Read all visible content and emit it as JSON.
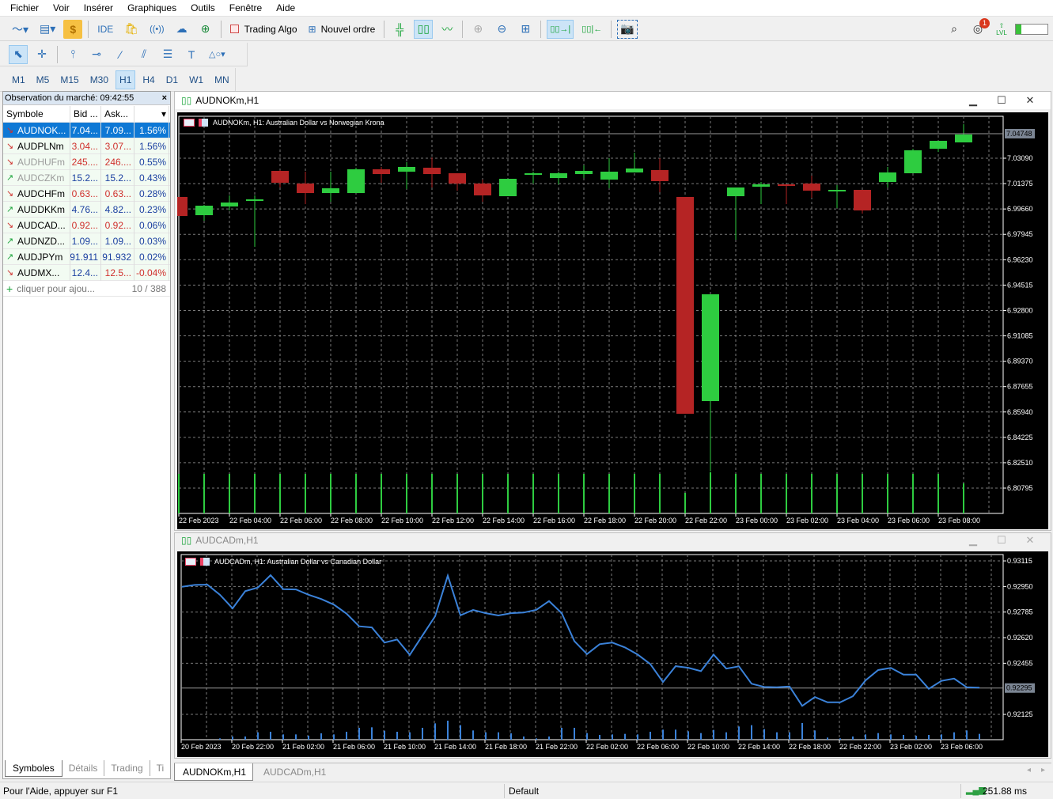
{
  "menu": [
    "Fichier",
    "Voir",
    "Insérer",
    "Graphiques",
    "Outils",
    "Fenêtre",
    "Aide"
  ],
  "toolbar": {
    "ide": "IDE",
    "trading_algo": "Trading Algo",
    "new_order": "Nouvel ordre",
    "notif_count": "1",
    "lvl": "LVL",
    "level_fill": 0.18
  },
  "timeframes": [
    "M1",
    "M5",
    "M15",
    "M30",
    "H1",
    "H4",
    "D1",
    "W1",
    "MN"
  ],
  "timeframe_active": "H1",
  "market_watch": {
    "title": "Observation du marché: 09:42:55",
    "columns": [
      "Symbole",
      "Bid ...",
      "Ask...",
      ""
    ],
    "rows": [
      {
        "symbol": "AUDNOK...",
        "bid": "7.04...",
        "ask": "7.09...",
        "change": "1.56%",
        "dir": "down",
        "bid_color": "#ffffff",
        "ask_color": "#ffffff",
        "chg_color": "#ffffff",
        "sym_color": "#ffffff",
        "selected": true
      },
      {
        "symbol": "AUDPLNm",
        "bid": "3.04...",
        "ask": "3.07...",
        "change": "1.56%",
        "dir": "down",
        "bid_color": "#d0312d",
        "ask_color": "#d0312d",
        "chg_color": "#1a3fa0",
        "sym_color": "#000000"
      },
      {
        "symbol": "AUDHUFm",
        "bid": "245....",
        "ask": "246....",
        "change": "0.55%",
        "dir": "down",
        "bid_color": "#d0312d",
        "ask_color": "#d0312d",
        "chg_color": "#1a3fa0",
        "sym_color": "#9a9a9a"
      },
      {
        "symbol": "AUDCZKm",
        "bid": "15.2...",
        "ask": "15.2...",
        "change": "0.43%",
        "dir": "up",
        "bid_color": "#1a3fa0",
        "ask_color": "#1a3fa0",
        "chg_color": "#1a3fa0",
        "sym_color": "#9a9a9a"
      },
      {
        "symbol": "AUDCHFm",
        "bid": "0.63...",
        "ask": "0.63...",
        "change": "0.28%",
        "dir": "down",
        "bid_color": "#d0312d",
        "ask_color": "#d0312d",
        "chg_color": "#1a3fa0",
        "sym_color": "#000000"
      },
      {
        "symbol": "AUDDKKm",
        "bid": "4.76...",
        "ask": "4.82...",
        "change": "0.23%",
        "dir": "up",
        "bid_color": "#1a3fa0",
        "ask_color": "#1a3fa0",
        "chg_color": "#1a3fa0",
        "sym_color": "#000000"
      },
      {
        "symbol": "AUDCAD...",
        "bid": "0.92...",
        "ask": "0.92...",
        "change": "0.06%",
        "dir": "down",
        "bid_color": "#d0312d",
        "ask_color": "#d0312d",
        "chg_color": "#1a3fa0",
        "sym_color": "#000000"
      },
      {
        "symbol": "AUDNZD...",
        "bid": "1.09...",
        "ask": "1.09...",
        "change": "0.03%",
        "dir": "up",
        "bid_color": "#1a3fa0",
        "ask_color": "#1a3fa0",
        "chg_color": "#1a3fa0",
        "sym_color": "#000000"
      },
      {
        "symbol": "AUDJPYm",
        "bid": "91.911",
        "ask": "91.932",
        "change": "0.02%",
        "dir": "up",
        "bid_color": "#1a3fa0",
        "ask_color": "#1a3fa0",
        "chg_color": "#1a3fa0",
        "sym_color": "#000000"
      },
      {
        "symbol": "AUDMX...",
        "bid": "12.4...",
        "ask": "12.5...",
        "change": "-0.04%",
        "dir": "down",
        "bid_color": "#1a3fa0",
        "ask_color": "#d0312d",
        "chg_color": "#d0312d",
        "sym_color": "#000000"
      }
    ],
    "add_label": "cliquer pour ajou...",
    "count": "10 / 388",
    "tabs": [
      "Symboles",
      "Détails",
      "Trading",
      "Ti"
    ]
  },
  "chart_windows": [
    {
      "title": "AUDNOKm,H1",
      "header": "AUDNOKm, H1:  Australian Dollar vs Norwegian Krona"
    },
    {
      "title": "AUDCADm,H1",
      "header": "AUDCADm, H1:  Australian Dollar vs Canadian Dollar"
    }
  ],
  "chart_tabs": [
    "AUDNOKm,H1",
    "AUDCADm,H1"
  ],
  "status": {
    "help": "Pour l'Aide, appuyer sur F1",
    "profile": "Default",
    "ping": "251.88 ms"
  },
  "chart_data": [
    {
      "type": "candlestick",
      "title": "AUDNOKm, H1",
      "ylim": [
        6.79084,
        7.05924
      ],
      "y_ticks": [
        "7.03090",
        "7.01375",
        "6.99660",
        "6.97945",
        "6.96230",
        "6.94515",
        "6.92800",
        "6.91085",
        "6.89370",
        "6.87655",
        "6.85940",
        "6.84225",
        "6.82510",
        "6.80795"
      ],
      "current_price": "7.04748",
      "x_labels": [
        "22 Feb 2023",
        "22 Feb 04:00",
        "22 Feb 06:00",
        "22 Feb 08:00",
        "22 Feb 10:00",
        "22 Feb 12:00",
        "22 Feb 14:00",
        "22 Feb 16:00",
        "22 Feb 18:00",
        "22 Feb 20:00",
        "22 Feb 22:00",
        "23 Feb 00:00",
        "23 Feb 02:00",
        "23 Feb 04:00",
        "23 Feb 06:00",
        "23 Feb 08:00"
      ],
      "ohlc": [
        [
          7.0047,
          7.0047,
          6.99187,
          6.99187
        ],
        [
          6.9924,
          6.99935,
          6.98866,
          6.99882
        ],
        [
          6.99828,
          7.00577,
          6.99561,
          7.00096
        ],
        [
          7.00203,
          7.00577,
          6.97101,
          7.0031
        ],
        [
          7.02234,
          7.02288,
          7.01112,
          7.01432
        ],
        [
          7.01379,
          7.02181,
          6.99989,
          7.00737
        ],
        [
          7.00737,
          7.02181,
          7.00149,
          7.01058
        ],
        [
          7.00737,
          7.02448,
          7.00737,
          7.02341
        ],
        [
          7.02341,
          7.02502,
          7.01432,
          7.02021
        ],
        [
          7.02181,
          7.02823,
          7.01005,
          7.02502
        ],
        [
          7.02448,
          7.03143,
          7.01112,
          7.02021
        ],
        [
          7.02074,
          7.02074,
          7.00898,
          7.01379
        ],
        [
          7.01379,
          7.01646,
          7.00149,
          7.00577
        ],
        [
          7.00523,
          7.017,
          7.00523,
          7.017
        ],
        [
          7.02021,
          7.02181,
          7.01379,
          7.02074
        ],
        [
          7.01753,
          7.02181,
          7.01325,
          7.02074
        ],
        [
          7.02021,
          7.02609,
          7.01753,
          7.02234
        ],
        [
          7.01646,
          7.0309,
          7.01058,
          7.02181
        ],
        [
          7.02128,
          7.03464,
          7.02128,
          7.02395
        ],
        [
          7.02288,
          7.0309,
          7.00791,
          7.01539
        ],
        [
          7.0047,
          7.0047,
          6.85819,
          6.85819
        ],
        [
          6.86675,
          6.93893,
          6.81916,
          6.93893
        ],
        [
          7.00523,
          7.01112,
          6.97583,
          7.01112
        ],
        [
          7.01165,
          7.01486,
          6.99989,
          7.01325
        ],
        [
          7.01325,
          7.01325,
          6.99989,
          7.01272
        ],
        [
          7.01379,
          7.01914,
          7.00416,
          7.00898
        ],
        [
          7.00898,
          7.01272,
          6.99721,
          7.00951
        ],
        [
          7.00951,
          7.00951,
          6.99347,
          6.99561
        ],
        [
          7.01486,
          7.02502,
          7.01112,
          7.02128
        ],
        [
          7.02074,
          7.03732,
          7.02074,
          7.03625
        ],
        [
          7.03732,
          7.04266,
          7.03518,
          7.04266
        ],
        [
          7.04159,
          7.05389,
          7.04159,
          7.04694
        ]
      ],
      "volumes_relative": [
        50,
        50,
        50,
        50,
        50,
        50,
        50,
        50,
        50,
        50,
        50,
        50,
        50,
        50,
        50,
        50,
        50,
        50,
        50,
        50,
        26,
        52,
        50,
        50,
        50,
        50,
        50,
        50,
        50,
        50,
        50,
        38
      ],
      "colors": {
        "up": "#2ecc40",
        "down": "#b52424",
        "grid": "#7a7a7a",
        "volume": "#2ecc40"
      }
    },
    {
      "type": "line",
      "title": "AUDCADm, H1",
      "ylim": [
        0.91962,
        0.93156
      ],
      "y_ticks": [
        "0.93115",
        "0.92950",
        "0.92785",
        "0.92620",
        "0.92455",
        "0.92125"
      ],
      "current_price": "0.92295",
      "x_labels": [
        "20 Feb 2023",
        "20 Feb 22:00",
        "21 Feb 02:00",
        "21 Feb 06:00",
        "21 Feb 10:00",
        "21 Feb 14:00",
        "21 Feb 18:00",
        "21 Feb 22:00",
        "22 Feb 02:00",
        "22 Feb 06:00",
        "22 Feb 10:00",
        "22 Feb 14:00",
        "22 Feb 18:00",
        "22 Feb 22:00",
        "23 Feb 02:00",
        "23 Feb 06:00"
      ],
      "values": [
        0.92948,
        0.9296,
        0.92962,
        0.92897,
        0.92809,
        0.9292,
        0.92943,
        0.93023,
        0.92933,
        0.92931,
        0.92897,
        0.92869,
        0.92833,
        0.92775,
        0.92693,
        0.92686,
        0.92588,
        0.92608,
        0.92509,
        0.92634,
        0.92758,
        0.9302,
        0.92764,
        0.92799,
        0.92778,
        0.92763,
        0.92778,
        0.92782,
        0.928,
        0.92856,
        0.92778,
        0.92598,
        0.92514,
        0.92578,
        0.92588,
        0.92557,
        0.92511,
        0.9245,
        0.92334,
        0.92436,
        0.92426,
        0.92404,
        0.92511,
        0.9242,
        0.92435,
        0.92323,
        0.92302,
        0.923,
        0.92305,
        0.9218,
        0.92237,
        0.92203,
        0.92203,
        0.92242,
        0.92344,
        0.92411,
        0.92425,
        0.92382,
        0.92382,
        0.9229,
        0.92341,
        0.92356,
        0.923,
        0.92297
      ],
      "volumes_relative": [
        0,
        0,
        0,
        5,
        12,
        12,
        28,
        30,
        20,
        20,
        15,
        24,
        20,
        30,
        45,
        47,
        34,
        30,
        28,
        45,
        62,
        72,
        55,
        35,
        28,
        28,
        24,
        12,
        5,
        12,
        45,
        45,
        25,
        18,
        20,
        22,
        20,
        30,
        38,
        38,
        32,
        25,
        37,
        28,
        50,
        55,
        40,
        28,
        28,
        63,
        35,
        8,
        5,
        12,
        20,
        25,
        20,
        18,
        15,
        18,
        20,
        28,
        35,
        22
      ],
      "colors": {
        "line": "#3b82d9",
        "grid": "#7a7a7a",
        "volume": "#3b82d9"
      }
    }
  ]
}
